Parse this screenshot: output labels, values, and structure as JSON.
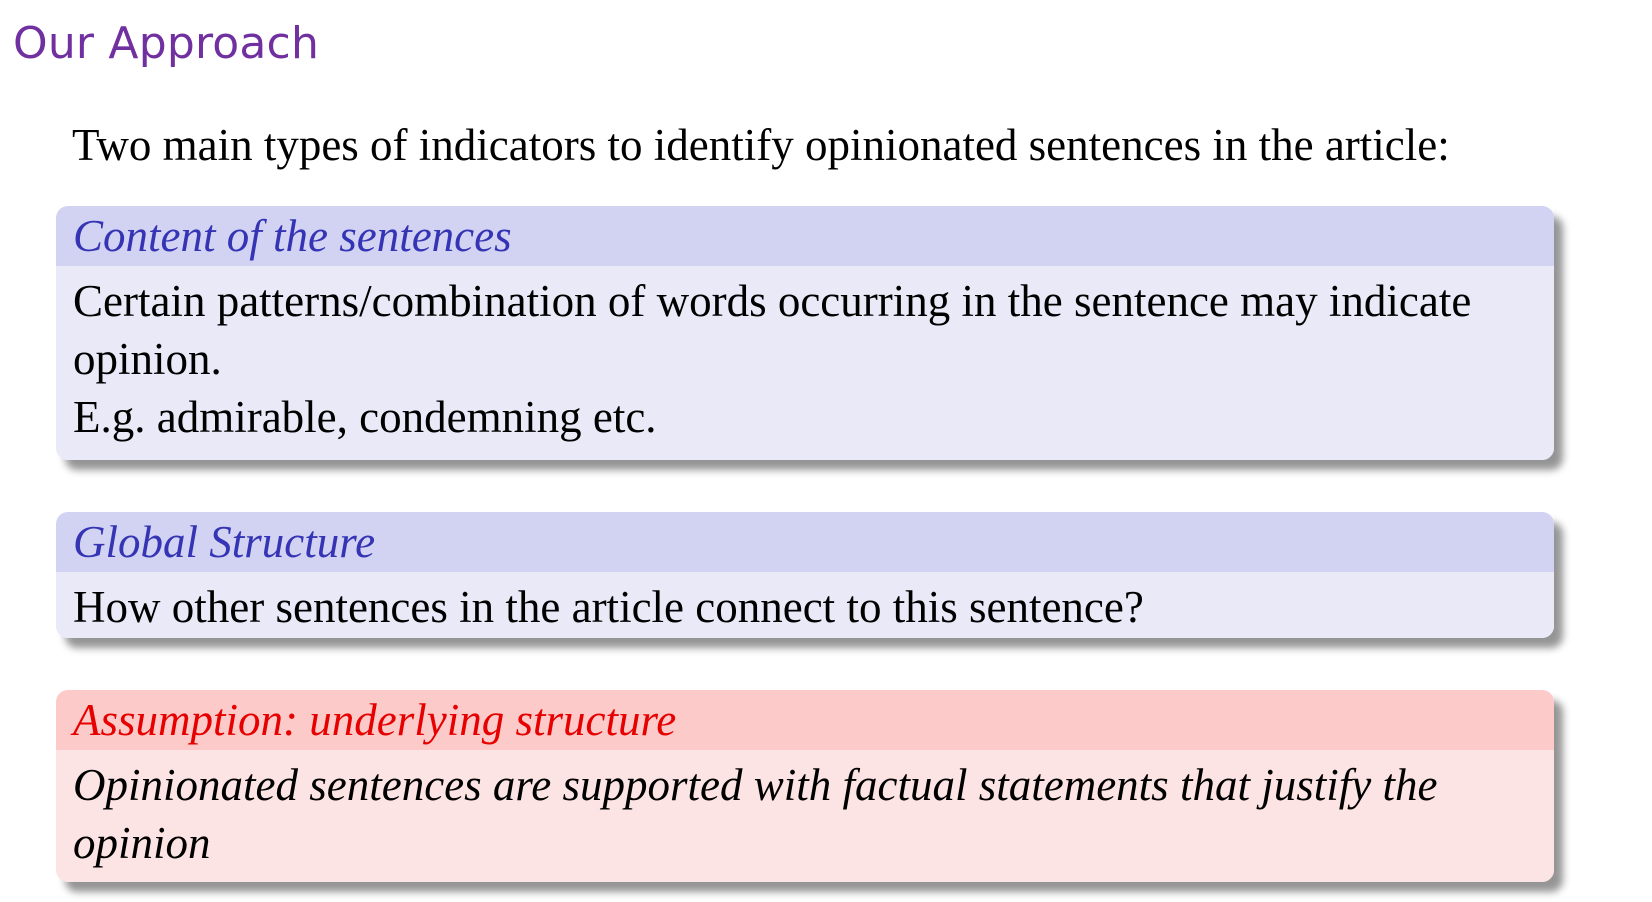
{
  "slide": {
    "title": "Our Approach",
    "intro": "Two main types of indicators to identify opinionated sentences in the article:"
  },
  "blocks": [
    {
      "title": "Content of the sentences",
      "lines": [
        "Certain patterns/combination of words occurring in the sentence may indicate",
        "opinion.",
        "E.g. admirable, condemning etc."
      ]
    },
    {
      "title": "Global Structure",
      "lines": [
        "How other sentences in the article connect to this sentence?"
      ]
    },
    {
      "title": "Assumption: underlying structure",
      "lines": [
        "Opinionated sentences are supported with factual statements that justify the",
        "opinion"
      ]
    }
  ],
  "colors": {
    "title": "#7030a0",
    "block_header_blue": "#d2d2f2",
    "block_title_blue": "#3434b4",
    "block_body_blue": "#e9e9f8",
    "alert_header_red": "#fdcaca",
    "alert_title_red": "#e60000",
    "alert_body_red": "#fde4e4"
  }
}
